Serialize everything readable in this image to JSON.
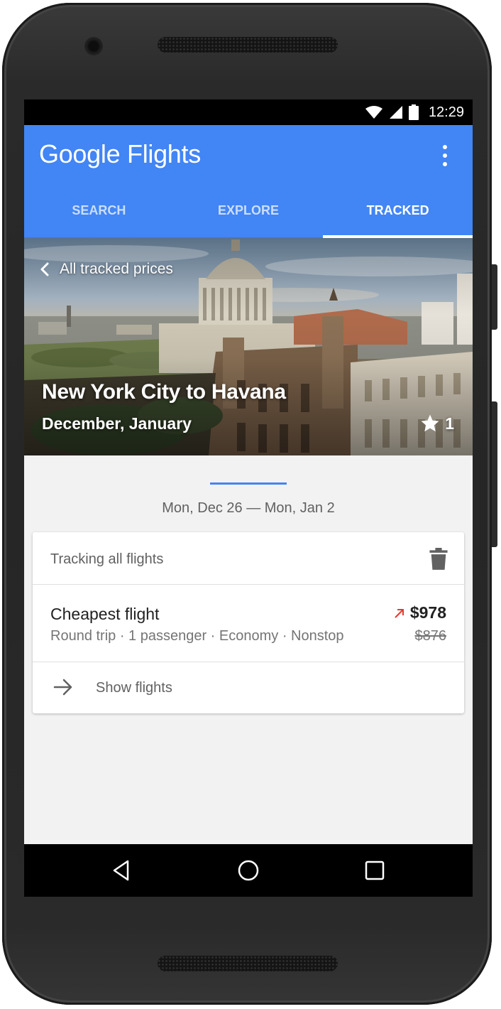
{
  "status_bar": {
    "time": "12:29",
    "icons": [
      "wifi-icon",
      "cell-signal-icon",
      "battery-icon"
    ]
  },
  "app_bar": {
    "logo_text": "Google",
    "title_word": "Flights",
    "menu_icon": "overflow-menu-icon",
    "color": "#4285f4"
  },
  "tabs": [
    {
      "label": "SEARCH",
      "active": false
    },
    {
      "label": "EXPLORE",
      "active": false
    },
    {
      "label": "TRACKED",
      "active": true
    }
  ],
  "hero": {
    "back_label": "All tracked prices",
    "route": "New York City to Havana",
    "months": "December, January",
    "star_count": "1"
  },
  "dates": {
    "range": "Mon, Dec 26 — Mon, Jan 2"
  },
  "card": {
    "tracking_label": "Tracking all flights",
    "flight": {
      "title": "Cheapest flight",
      "details": "Round trip · 1 passenger · Economy · Nonstop",
      "price_current": "$978",
      "price_previous": "$876",
      "price_trend": "up",
      "trend_color": "#e53935"
    },
    "show_flights_label": "Show flights"
  },
  "nav_bar": {
    "buttons": [
      "back-icon",
      "home-icon",
      "recents-icon"
    ]
  }
}
